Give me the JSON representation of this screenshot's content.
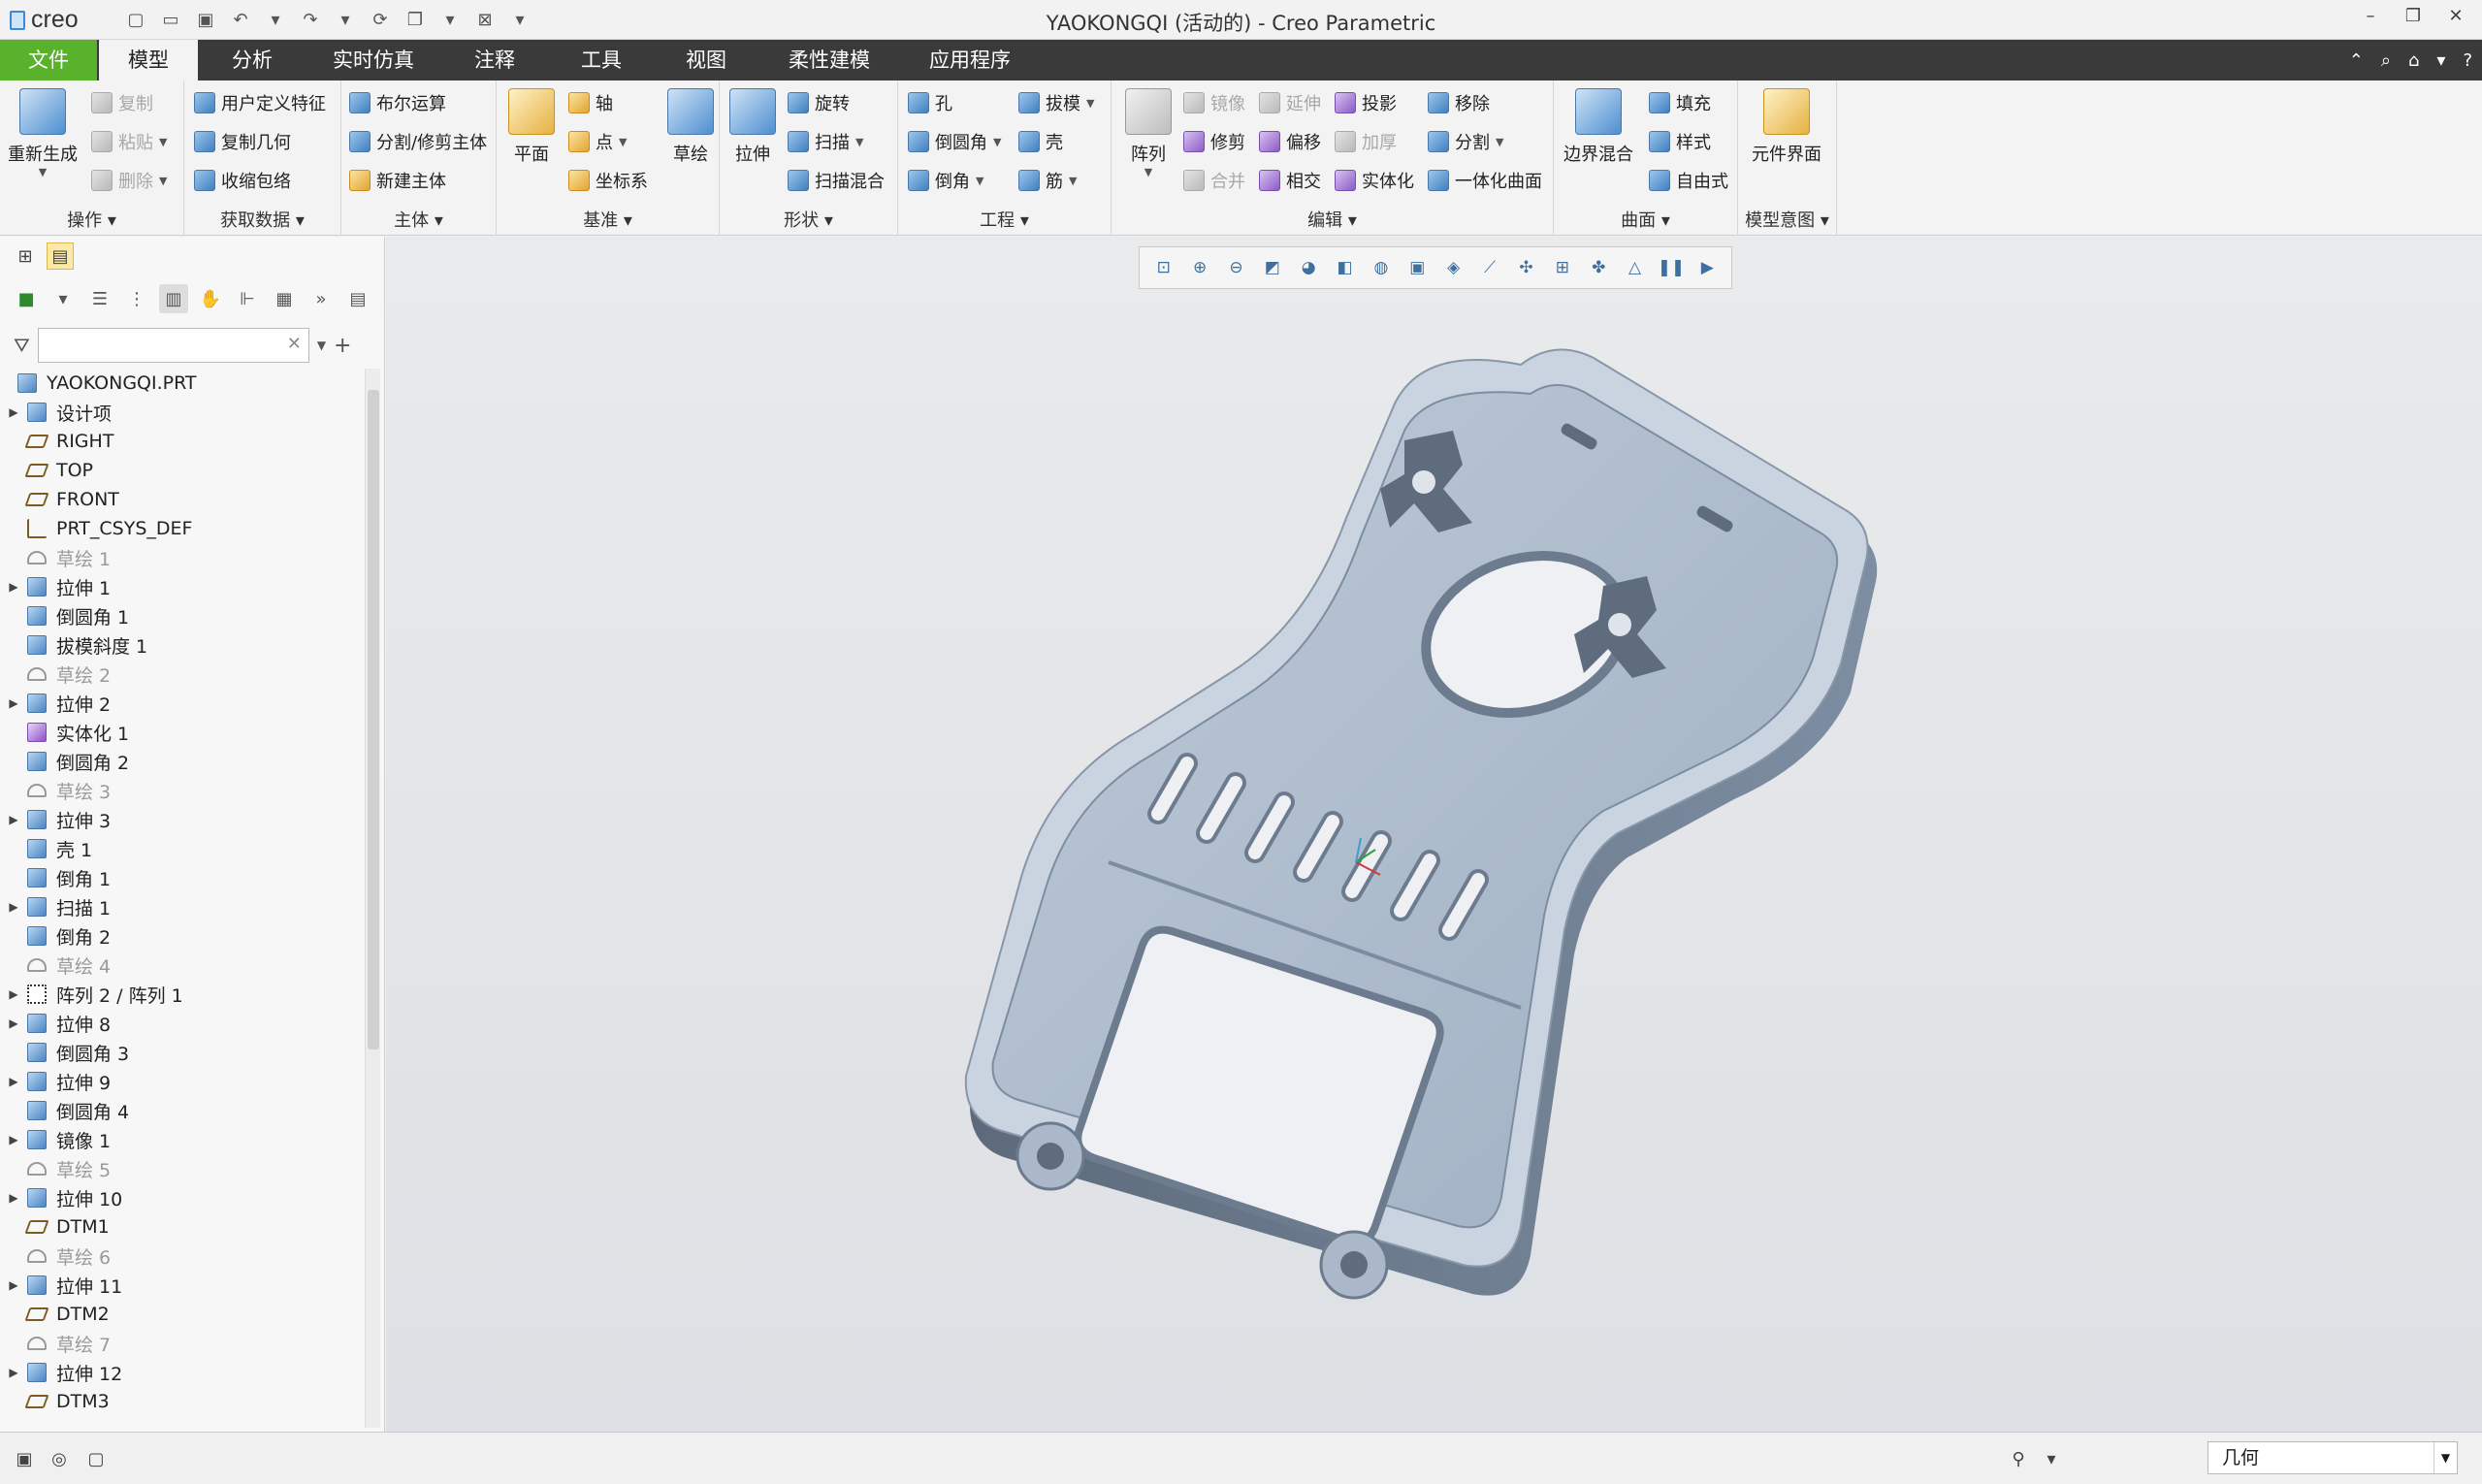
{
  "app": {
    "logo_text": "creo",
    "window_title": "YAOKONGQI (活动的) - Creo Parametric"
  },
  "menu": {
    "tabs": [
      "文件",
      "模型",
      "分析",
      "实时仿真",
      "注释",
      "工具",
      "视图",
      "柔性建模",
      "应用程序"
    ],
    "active_tab": "模型"
  },
  "ribbon": {
    "operations": {
      "title": "操作",
      "regenerate": "重新生成",
      "copy": "复制",
      "paste": "粘贴",
      "delete": "删除"
    },
    "get_data": {
      "title": "获取数据",
      "udf": "用户定义特征",
      "copy_geom": "复制几何",
      "shrinkwrap": "收缩包络"
    },
    "body": {
      "title": "主体",
      "boolean": "布尔运算",
      "split_trim": "分割/修剪主体",
      "new_body": "新建主体"
    },
    "datum": {
      "title": "基准",
      "plane": "平面",
      "axis": "轴",
      "point": "点",
      "csys": "坐标系",
      "sketch": "草绘"
    },
    "shapes": {
      "title": "形状",
      "extrude": "拉伸",
      "revolve": "旋转",
      "sweep": "扫描",
      "swept_blend": "扫描混合"
    },
    "engineering": {
      "title": "工程",
      "hole": "孔",
      "round": "倒圆角",
      "chamfer": "倒角",
      "draft": "拔模",
      "shell": "壳",
      "rib": "筋"
    },
    "editing": {
      "title": "编辑",
      "pattern": "阵列",
      "mirror": "镜像",
      "trim": "修剪",
      "merge": "合并",
      "extend": "延伸",
      "offset": "偏移",
      "intersect": "相交",
      "project": "投影",
      "thicken": "加厚",
      "solidify": "实体化",
      "remove": "移除",
      "split": "分割",
      "unify": "一体化曲面"
    },
    "surfaces": {
      "title": "曲面",
      "boundary_blend": "边界混合",
      "fill": "填充",
      "style": "样式",
      "freestyle": "自由式"
    },
    "intent": {
      "title": "模型意图",
      "component_interface": "元件界面"
    }
  },
  "model_tree": {
    "search_value": "",
    "root": "YAOKONGQI.PRT",
    "items": [
      {
        "label": "设计项",
        "icon": "design-items-icon",
        "expandable": true,
        "dim": false
      },
      {
        "label": "RIGHT",
        "icon": "datum-plane-icon",
        "expandable": false,
        "dim": false
      },
      {
        "label": "TOP",
        "icon": "datum-plane-icon",
        "expandable": false,
        "dim": false
      },
      {
        "label": "FRONT",
        "icon": "datum-plane-icon",
        "expandable": false,
        "dim": false
      },
      {
        "label": "PRT_CSYS_DEF",
        "icon": "csys-icon",
        "expandable": false,
        "dim": false
      },
      {
        "label": "草绘 1",
        "icon": "sketch-icon",
        "expandable": false,
        "dim": true
      },
      {
        "label": "拉伸 1",
        "icon": "extrude-icon",
        "expandable": true,
        "dim": false
      },
      {
        "label": "倒圆角 1",
        "icon": "round-icon",
        "expandable": false,
        "dim": false
      },
      {
        "label": "拔模斜度 1",
        "icon": "draft-icon",
        "expandable": false,
        "dim": false
      },
      {
        "label": "草绘 2",
        "icon": "sketch-icon",
        "expandable": false,
        "dim": true
      },
      {
        "label": "拉伸 2",
        "icon": "extrude-icon",
        "expandable": true,
        "dim": false
      },
      {
        "label": "实体化 1",
        "icon": "solidify-icon",
        "expandable": false,
        "dim": false
      },
      {
        "label": "倒圆角 2",
        "icon": "round-icon",
        "expandable": false,
        "dim": false
      },
      {
        "label": "草绘 3",
        "icon": "sketch-icon",
        "expandable": false,
        "dim": true
      },
      {
        "label": "拉伸 3",
        "icon": "extrude-icon",
        "expandable": true,
        "dim": false
      },
      {
        "label": "壳 1",
        "icon": "shell-icon",
        "expandable": false,
        "dim": false
      },
      {
        "label": "倒角 1",
        "icon": "chamfer-icon",
        "expandable": false,
        "dim": false
      },
      {
        "label": "扫描 1",
        "icon": "sweep-icon",
        "expandable": true,
        "dim": false
      },
      {
        "label": "倒角 2",
        "icon": "chamfer-icon",
        "expandable": false,
        "dim": false
      },
      {
        "label": "草绘 4",
        "icon": "sketch-icon",
        "expandable": false,
        "dim": true
      },
      {
        "label": "阵列 2 / 阵列 1",
        "icon": "pattern-icon",
        "expandable": true,
        "dim": false
      },
      {
        "label": "拉伸 8",
        "icon": "extrude-icon",
        "expandable": true,
        "dim": false
      },
      {
        "label": "倒圆角 3",
        "icon": "round-icon",
        "expandable": false,
        "dim": false
      },
      {
        "label": "拉伸 9",
        "icon": "extrude-icon",
        "expandable": true,
        "dim": false
      },
      {
        "label": "倒圆角 4",
        "icon": "round-icon",
        "expandable": false,
        "dim": false
      },
      {
        "label": "镜像 1",
        "icon": "mirror-icon",
        "expandable": true,
        "dim": false
      },
      {
        "label": "草绘 5",
        "icon": "sketch-icon",
        "expandable": false,
        "dim": true
      },
      {
        "label": "拉伸 10",
        "icon": "extrude-icon",
        "expandable": true,
        "dim": false
      },
      {
        "label": "DTM1",
        "icon": "datum-plane-icon",
        "expandable": false,
        "dim": false
      },
      {
        "label": "草绘 6",
        "icon": "sketch-icon",
        "expandable": false,
        "dim": true
      },
      {
        "label": "拉伸 11",
        "icon": "extrude-icon",
        "expandable": true,
        "dim": false
      },
      {
        "label": "DTM2",
        "icon": "datum-plane-icon",
        "expandable": false,
        "dim": false
      },
      {
        "label": "草绘 7",
        "icon": "sketch-icon",
        "expandable": false,
        "dim": true
      },
      {
        "label": "拉伸 12",
        "icon": "extrude-icon",
        "expandable": true,
        "dim": false
      },
      {
        "label": "DTM3",
        "icon": "datum-plane-icon",
        "expandable": false,
        "dim": false
      }
    ]
  },
  "status": {
    "selection_filter": "几何"
  },
  "colors": {
    "file_tab": "#5ab12c",
    "menubar": "#3a3a3a",
    "model_face": "#a9b8c9",
    "model_side": "#6b7a8c"
  }
}
